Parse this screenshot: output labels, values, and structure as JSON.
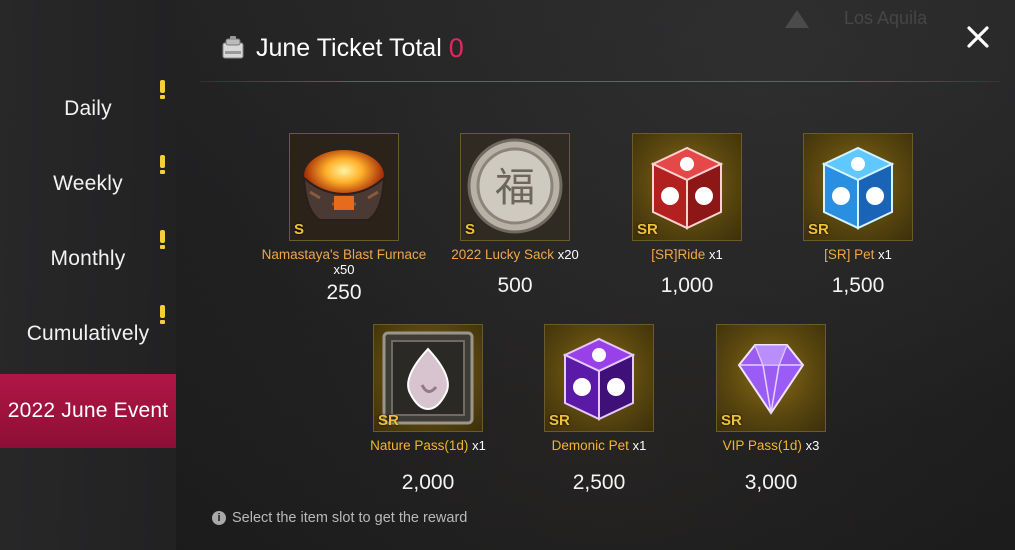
{
  "header": {
    "title": "June Ticket Total",
    "total": "0"
  },
  "sidebar": {
    "tabs": [
      {
        "label": "Daily",
        "alert": true
      },
      {
        "label": "Weekly",
        "alert": true
      },
      {
        "label": "Monthly",
        "alert": true
      },
      {
        "label": "Cumulatively",
        "alert": true
      },
      {
        "label": "2022 June Event",
        "alert": false,
        "active": true
      }
    ]
  },
  "rewards": [
    {
      "name": "Namastaya's Blast Furnace",
      "qty": "x50",
      "grade": "S",
      "value": "250",
      "icon": "furnace-icon"
    },
    {
      "name": "2022 Lucky Sack",
      "qty": "x20",
      "grade": "S",
      "value": "500",
      "icon": "lucky-coin-icon",
      "glyph": "福"
    },
    {
      "name": "[SR]Ride",
      "qty": "x1",
      "grade": "SR",
      "value": "1,000",
      "icon": "ride-box-icon"
    },
    {
      "name": "[SR] Pet",
      "qty": "x1",
      "grade": "SR",
      "value": "1,500",
      "icon": "pet-box-icon"
    },
    {
      "name": "Nature Pass(1d)",
      "qty": "x1",
      "grade": "SR",
      "value": "2,000",
      "icon": "nature-pass-icon"
    },
    {
      "name": "Demonic Pet",
      "qty": "x1",
      "grade": "SR",
      "value": "2,500",
      "icon": "demonic-pet-box-icon"
    },
    {
      "name": "VIP Pass(1d)",
      "qty": "x3",
      "grade": "SR",
      "value": "3,000",
      "icon": "vip-diamond-icon"
    }
  ],
  "footer": {
    "hint": "Select the item slot to get the reward"
  },
  "colors": {
    "accent": "#b01647",
    "total": "#e8245e",
    "gold_text": "#f3b52a",
    "orange_text": "#f1a64a"
  },
  "background": {
    "map_label": "Los Aquila"
  }
}
